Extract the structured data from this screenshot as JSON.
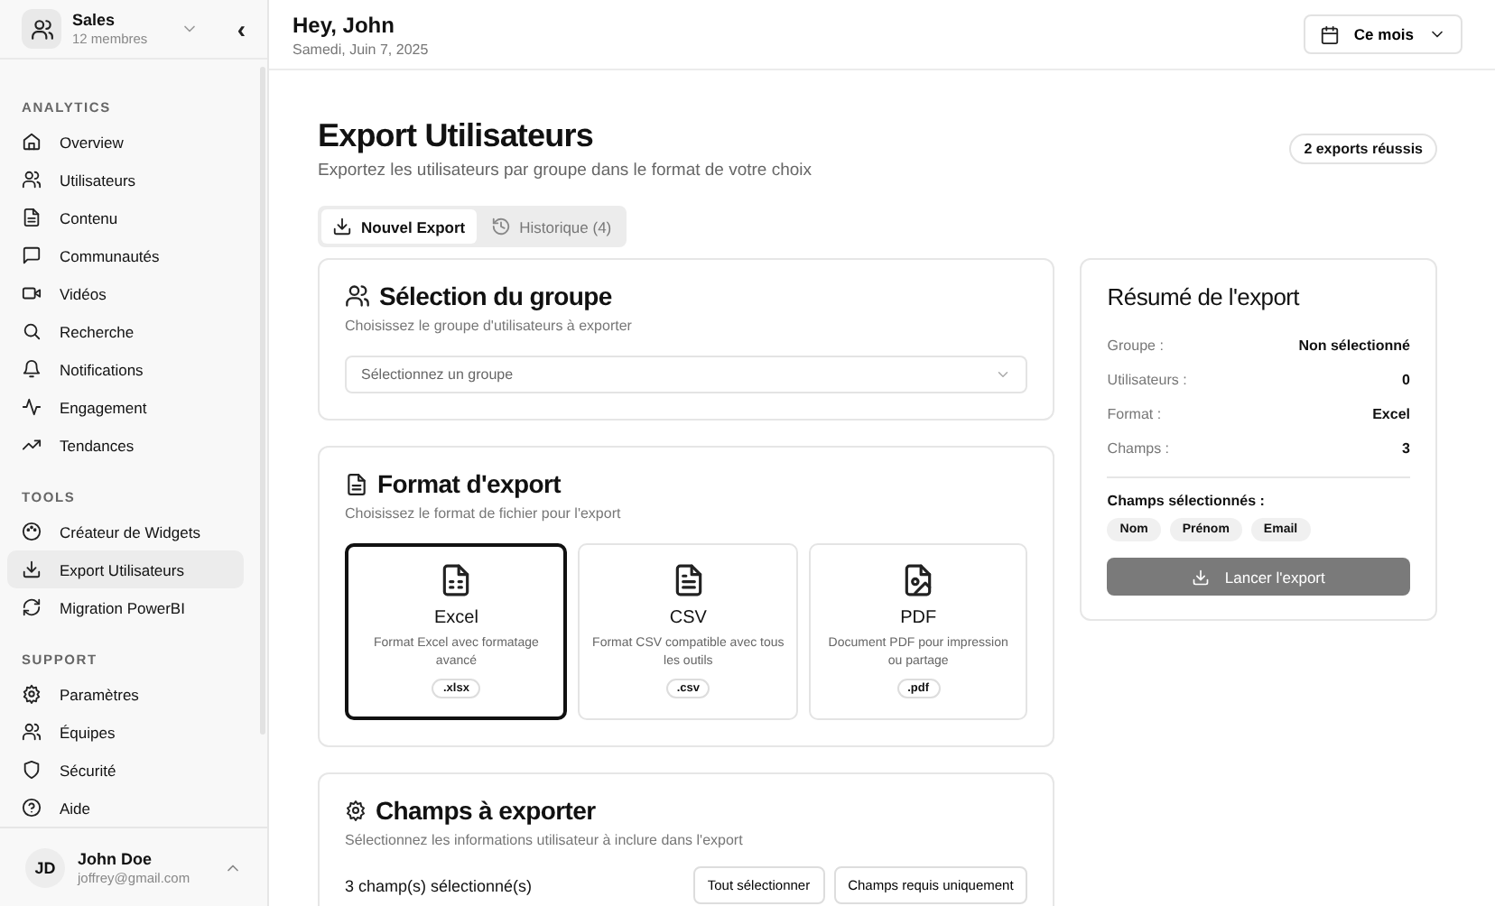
{
  "workspace": {
    "name": "Sales",
    "members": "12 membres",
    "collapse": "‹"
  },
  "sidebar": {
    "sections": [
      {
        "title": "ANALYTICS",
        "items": [
          {
            "label": "Overview",
            "selected": false
          },
          {
            "label": "Utilisateurs",
            "selected": false
          },
          {
            "label": "Contenu",
            "selected": false
          },
          {
            "label": "Communautés",
            "selected": false
          },
          {
            "label": "Vidéos",
            "selected": false
          },
          {
            "label": "Recherche",
            "selected": false
          },
          {
            "label": "Notifications",
            "selected": false
          },
          {
            "label": "Engagement",
            "selected": false
          },
          {
            "label": "Tendances",
            "selected": false
          }
        ]
      },
      {
        "title": "TOOLS",
        "items": [
          {
            "label": "Créateur de Widgets",
            "selected": false
          },
          {
            "label": "Export Utilisateurs",
            "selected": true
          },
          {
            "label": "Migration PowerBI",
            "selected": false
          }
        ]
      },
      {
        "title": "SUPPORT",
        "items": [
          {
            "label": "Paramètres",
            "selected": false
          },
          {
            "label": "Équipes",
            "selected": false
          },
          {
            "label": "Sécurité",
            "selected": false
          },
          {
            "label": "Aide",
            "selected": false
          }
        ]
      }
    ]
  },
  "user": {
    "initials": "JD",
    "name": "John Doe",
    "email": "joffrey@gmail.com"
  },
  "header": {
    "greeting": "Hey, John",
    "date": "Samedi, Juin 7, 2025",
    "period": "Ce mois"
  },
  "page": {
    "title": "Export Utilisateurs",
    "subtitle": "Exportez les utilisateurs par groupe dans le format de votre choix",
    "badge": "2 exports réussis"
  },
  "tabs": [
    {
      "label": "Nouvel Export",
      "selected": true
    },
    {
      "label": "Historique (4)",
      "selected": false
    }
  ],
  "group_card": {
    "title": "Sélection du groupe",
    "subtitle": "Choisissez le groupe d'utilisateurs à exporter",
    "select": {
      "placeholder": "Sélectionnez un groupe"
    }
  },
  "format_card": {
    "title": "Format d'export",
    "subtitle": "Choisissez le format de fichier pour l'export",
    "formats": [
      {
        "name": "Excel",
        "description": "Format Excel avec formatage avancé",
        "extension": ".xlsx",
        "selected": true
      },
      {
        "name": "CSV",
        "description": "Format CSV compatible avec tous les outils",
        "extension": ".csv",
        "selected": false
      },
      {
        "name": "PDF",
        "description": "Document PDF pour impression ou partage",
        "extension": ".pdf",
        "selected": false
      }
    ]
  },
  "fields_card": {
    "title": "Champs à exporter",
    "subtitle": "Sélectionnez les informations utilisateur à inclure dans l'export",
    "count": "3 champ(s) sélectionné(s)",
    "buttons": [
      "Tout sélectionner",
      "Champs requis uniquement"
    ]
  },
  "summary": {
    "title": "Résumé de l'export",
    "rows": [
      {
        "label": "Groupe :",
        "value": "Non sélectionné"
      },
      {
        "label": "Utilisateurs :",
        "value": "0"
      },
      {
        "label": "Format :",
        "value": "Excel"
      },
      {
        "label": "Champs :",
        "value": "3"
      }
    ],
    "fields_title": "Champs sélectionnés :",
    "fields": [
      "Nom",
      "Prénom",
      "Email"
    ],
    "button": {
      "label": "Lancer l'export",
      "disabled": true
    }
  }
}
